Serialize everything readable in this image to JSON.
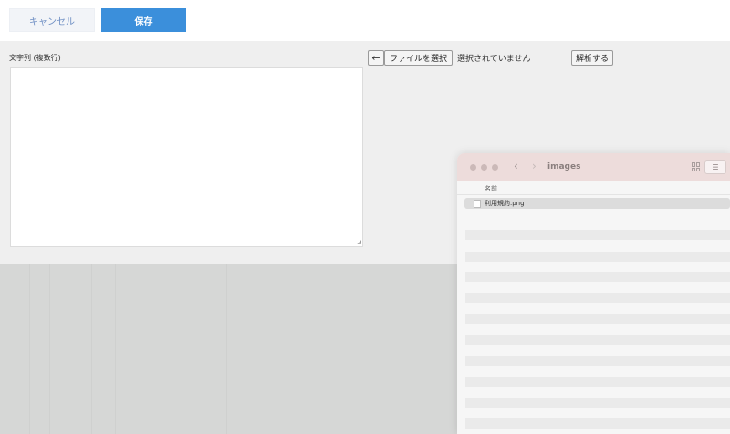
{
  "toolbar": {
    "cancel_label": "キャンセル",
    "save_label": "保存"
  },
  "form": {
    "text_label": "文字列 (複数行)",
    "text_value": "",
    "file_nav_label": "←",
    "choose_file_label": "ファイルを選択",
    "file_status": "選択されていません",
    "analyze_label": "解析する"
  },
  "finder": {
    "title": "images",
    "back_glyph": "‹",
    "forward_glyph": "›",
    "view_list_glyph": "☰",
    "column_name": "名前",
    "files": [
      {
        "name": "利用規約.png",
        "selected": true
      }
    ]
  },
  "colors": {
    "primary": "#3b8fdb",
    "cancel_text": "#6f8fc4",
    "finder_titlebar": "#eddcdb"
  }
}
